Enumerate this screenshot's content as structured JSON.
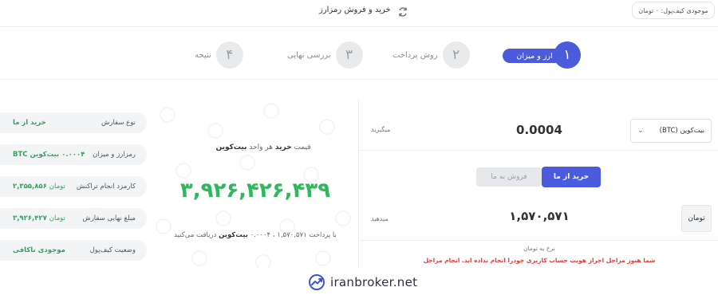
{
  "header": {
    "wallet_balance": "موجودی کیف‌پول: ۰ تومان",
    "title": "خرید و فروش رمزارز"
  },
  "stepper": {
    "steps": [
      {
        "num": "۱",
        "label": "ارز و میزان",
        "active": true
      },
      {
        "num": "۲",
        "label": "روش پرداخت",
        "active": false
      },
      {
        "num": "۳",
        "label": "بررسی نهایی",
        "active": false
      },
      {
        "num": "۴",
        "label": "نتیجه",
        "active": false
      }
    ]
  },
  "summary": {
    "rows": [
      {
        "label": "نوع سفارش",
        "value": "خرید از ما"
      },
      {
        "label": "رمزارز و میزان",
        "value": "۰.۰۰۰۴ بیت‌کوین BTC"
      },
      {
        "label": "کارمزد انجام تراکنش",
        "value": "۲,۳۵۵,۸۵۶",
        "unit": "تومان"
      },
      {
        "label": "مبلغ نهایی سفارش",
        "value": "۳,۹۲۶,۴۲۷",
        "unit": "تومان"
      },
      {
        "label": "وضعیت کیف‌پول",
        "value": "موجودی ناکافی"
      }
    ]
  },
  "price_box": {
    "caption_pre": "قیمت",
    "caption_action": "خرید",
    "caption_mid": "هر واحد",
    "caption_coin": "بیت‌کوین",
    "big_price": "۳,۹۲۶,۴۲۶,۴۳۹",
    "pay_pre": "با پرداخت",
    "pay_amount": "۱,۵۷۰,۵۷۱",
    "pay_get": "۰.۰۰۰۴",
    "pay_coin": "بیت‌کوین",
    "pay_post": "دریافت می‌کنید"
  },
  "form": {
    "coin_select": "بیت‌کوین (BTC)",
    "receive_label": "میگیرید",
    "receive_amount": "0.0004",
    "buy_label": "خرید از ما",
    "sell_label": "فروش به ما",
    "pay_label": "میدهید",
    "pay_amount": "۱,۵۷۰,۵۷۱",
    "currency": "تومان",
    "rate_label": "نرخ به تومان",
    "warning_text": "شما هنوز مراحل احراز هویت حساب کاربری خودرا انجام نداده اید.",
    "warning_link": "انجام مراحل"
  },
  "brand": {
    "name": "iranbroker.net"
  },
  "colors": {
    "accent": "#4a5bdc",
    "green": "#2fb85e",
    "warning": "#e23b3b"
  }
}
